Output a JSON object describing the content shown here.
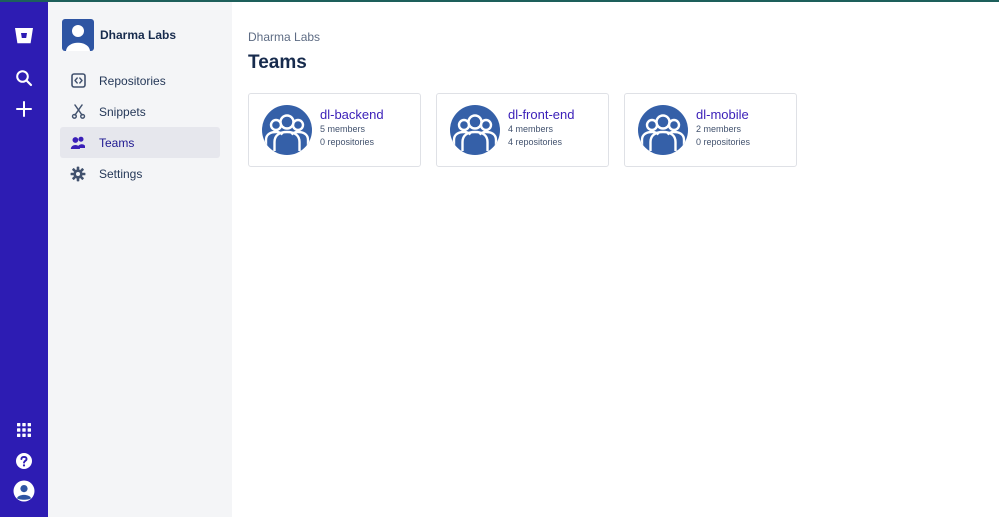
{
  "globalnav": {
    "icons": {
      "logo": "bitbucket-logo-icon",
      "search": "search-icon",
      "create": "plus-icon",
      "apps": "app-switcher-icon",
      "help": "help-icon",
      "profile": "profile-avatar-icon"
    },
    "colors": {
      "background": "#2d1cb3",
      "icon": "#ffffff"
    }
  },
  "sidebar": {
    "workspace_name": "Dharma Labs",
    "items": [
      {
        "label": "Repositories",
        "icon": "code-repository-icon",
        "active": false
      },
      {
        "label": "Snippets",
        "icon": "scissors-icon",
        "active": false
      },
      {
        "label": "Teams",
        "icon": "people-icon",
        "active": true
      },
      {
        "label": "Settings",
        "icon": "gear-icon",
        "active": false
      }
    ]
  },
  "main": {
    "breadcrumb": "Dharma Labs",
    "title": "Teams",
    "teams": [
      {
        "name": "dl-backend",
        "members": "5 members",
        "repositories": "0 repositories"
      },
      {
        "name": "dl-front-end",
        "members": "4 members",
        "repositories": "4 repositories"
      },
      {
        "name": "dl-mobile",
        "members": "2 members",
        "repositories": "0 repositories"
      }
    ]
  },
  "colors": {
    "accent": "#2d1cb3",
    "team_avatar": "#3560a8",
    "link": "#3a1fb8"
  }
}
